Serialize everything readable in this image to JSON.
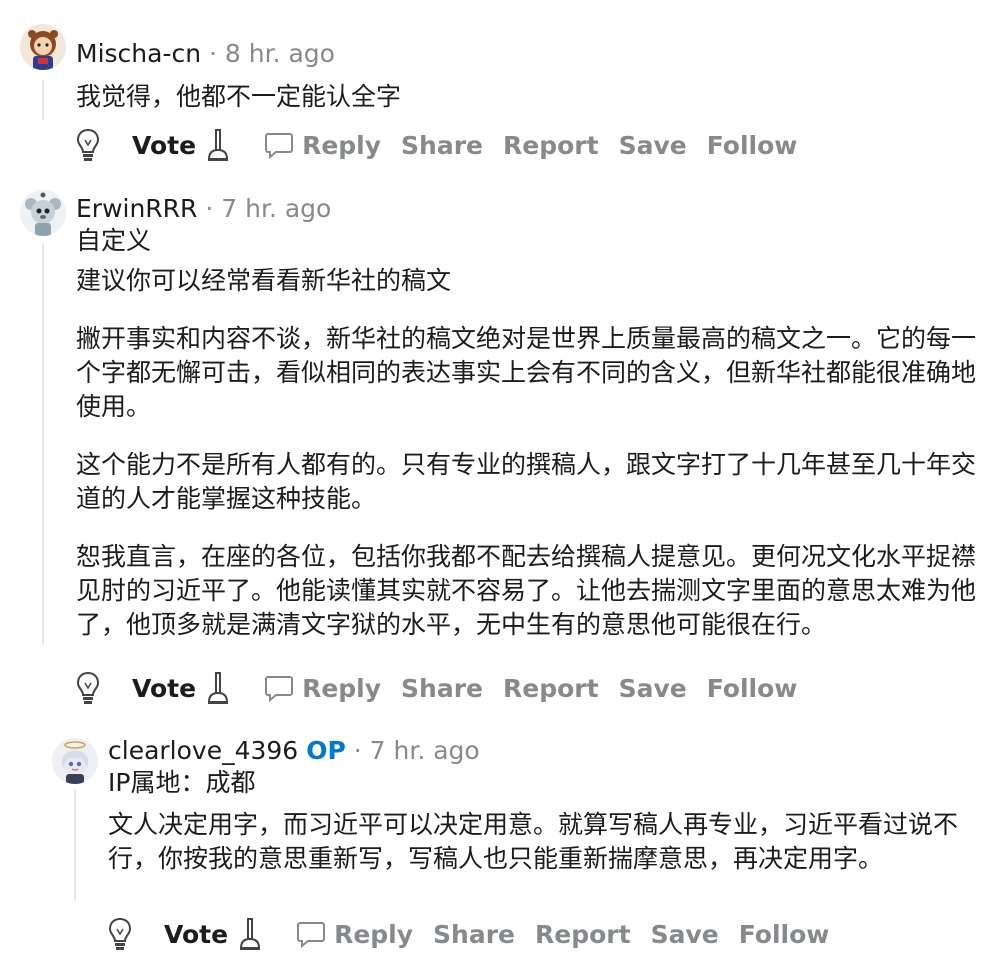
{
  "action_labels": {
    "vote": "Vote",
    "reply": "Reply",
    "share": "Share",
    "report": "Report",
    "save": "Save",
    "follow": "Follow"
  },
  "comments": [
    {
      "username": "Mischa-cn",
      "meta": "· 8 hr. ago",
      "body": [
        "我觉得，他都不一定能认全字"
      ]
    },
    {
      "username": "ErwinRRR",
      "meta": "· 7 hr. ago",
      "flair": "自定义",
      "body": [
        "建议你可以经常看看新华社的稿文",
        "撇开事实和内容不谈，新华社的稿文绝对是世界上质量最高的稿文之一。它的每一个字都无懈可击，看似相同的表达事实上会有不同的含义，但新华社都能很准确地使用。",
        "这个能力不是所有人都有的。只有专业的撰稿人，跟文字打了十几年甚至几十年交道的人才能掌握这种技能。",
        "恕我直言，在座的各位，包括你我都不配去给撰稿人提意见。更何况文化水平捉襟见肘的习近平了。他能读懂其实就不容易了。让他去揣测文字里面的意思太难为他了，他顶多就是满清文字狱的水平，无中生有的意思他可能很在行。"
      ]
    },
    {
      "username": "clearlove_4396",
      "op_badge": "OP",
      "meta": "· 7 hr. ago",
      "flair": "IP属地：成都",
      "body": [
        "文人决定用字，而习近平可以决定用意。就算写稿人再专业，习近平看过说不行，你按我的意思重新写，写稿人也只能重新揣摩意思，再决定用字。"
      ]
    }
  ]
}
